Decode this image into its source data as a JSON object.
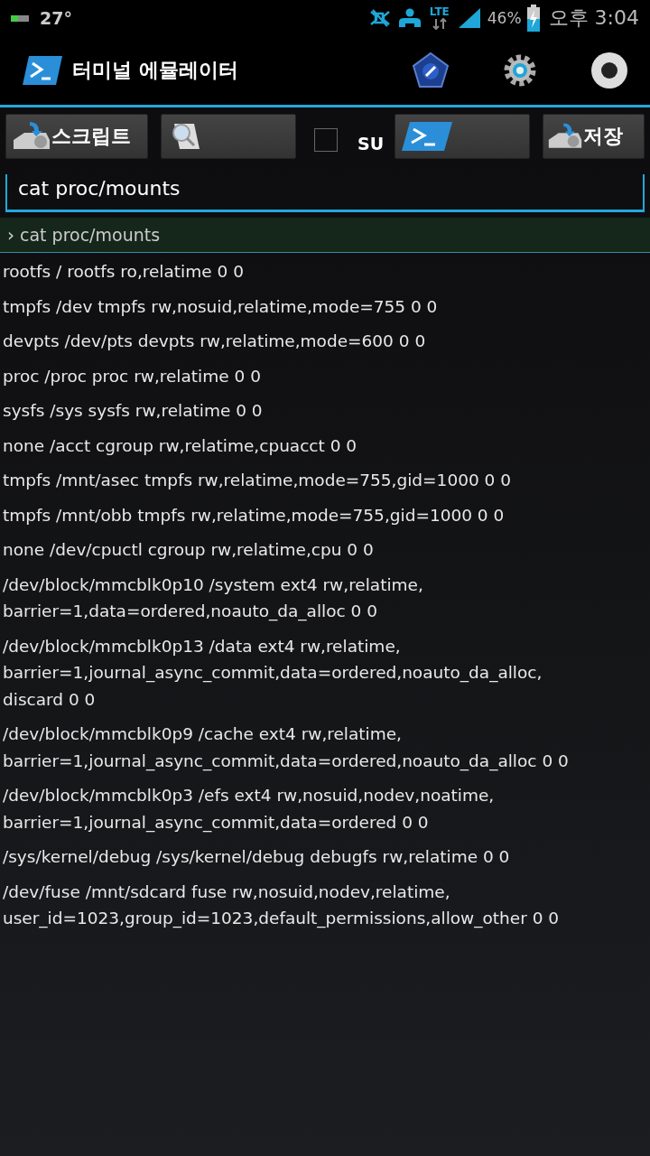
{
  "status_bar": {
    "temperature": "27°",
    "network_type": "LTE",
    "battery_percent": "46%",
    "time": "오후 3:04"
  },
  "app_bar": {
    "title": "터미널 에뮬레이터"
  },
  "toolbar": {
    "script_button": "스크립트",
    "su_checked": false,
    "su_label": "SU",
    "save_button": "저장"
  },
  "command_field": {
    "value": "cat proc/mounts"
  },
  "echo": {
    "prompt": "›",
    "command": "cat proc/mounts"
  },
  "output": [
    {
      "lines": [
        "rootfs / rootfs ro,relatime 0 0"
      ]
    },
    {
      "lines": [
        "tmpfs /dev tmpfs rw,nosuid,relatime,mode=755 0 0"
      ]
    },
    {
      "lines": [
        "devpts /dev/pts devpts rw,relatime,mode=600 0 0"
      ]
    },
    {
      "lines": [
        "proc /proc proc rw,relatime 0 0"
      ]
    },
    {
      "lines": [
        "sysfs /sys sysfs rw,relatime 0 0"
      ]
    },
    {
      "lines": [
        "none /acct cgroup rw,relatime,cpuacct 0 0"
      ]
    },
    {
      "lines": [
        "tmpfs /mnt/asec tmpfs rw,relatime,mode=755,gid=1000 0 0"
      ]
    },
    {
      "lines": [
        "tmpfs /mnt/obb tmpfs rw,relatime,mode=755,gid=1000 0 0"
      ]
    },
    {
      "lines": [
        "none /dev/cpuctl cgroup rw,relatime,cpu 0 0"
      ]
    },
    {
      "lines": [
        "/dev/block/mmcblk0p10 /system ext4 rw,relatime,",
        "barrier=1,data=ordered,noauto_da_alloc 0 0"
      ]
    },
    {
      "lines": [
        "/dev/block/mmcblk0p13 /data ext4 rw,relatime,",
        "barrier=1,journal_async_commit,data=ordered,noauto_da_alloc,",
        "discard 0 0"
      ]
    },
    {
      "lines": [
        "/dev/block/mmcblk0p9 /cache ext4 rw,relatime,",
        "barrier=1,journal_async_commit,data=ordered,noauto_da_alloc 0 0"
      ]
    },
    {
      "lines": [
        "/dev/block/mmcblk0p3 /efs ext4 rw,nosuid,nodev,noatime,",
        "barrier=1,journal_async_commit,data=ordered 0 0"
      ]
    },
    {
      "lines": [
        "/sys/kernel/debug /sys/kernel/debug debugfs rw,relatime 0 0"
      ]
    },
    {
      "lines": [
        "/dev/fuse /mnt/sdcard fuse rw,nosuid,nodev,relatime,",
        "user_id=1023,group_id=1023,default_permissions,allow_other 0 0"
      ]
    }
  ]
}
